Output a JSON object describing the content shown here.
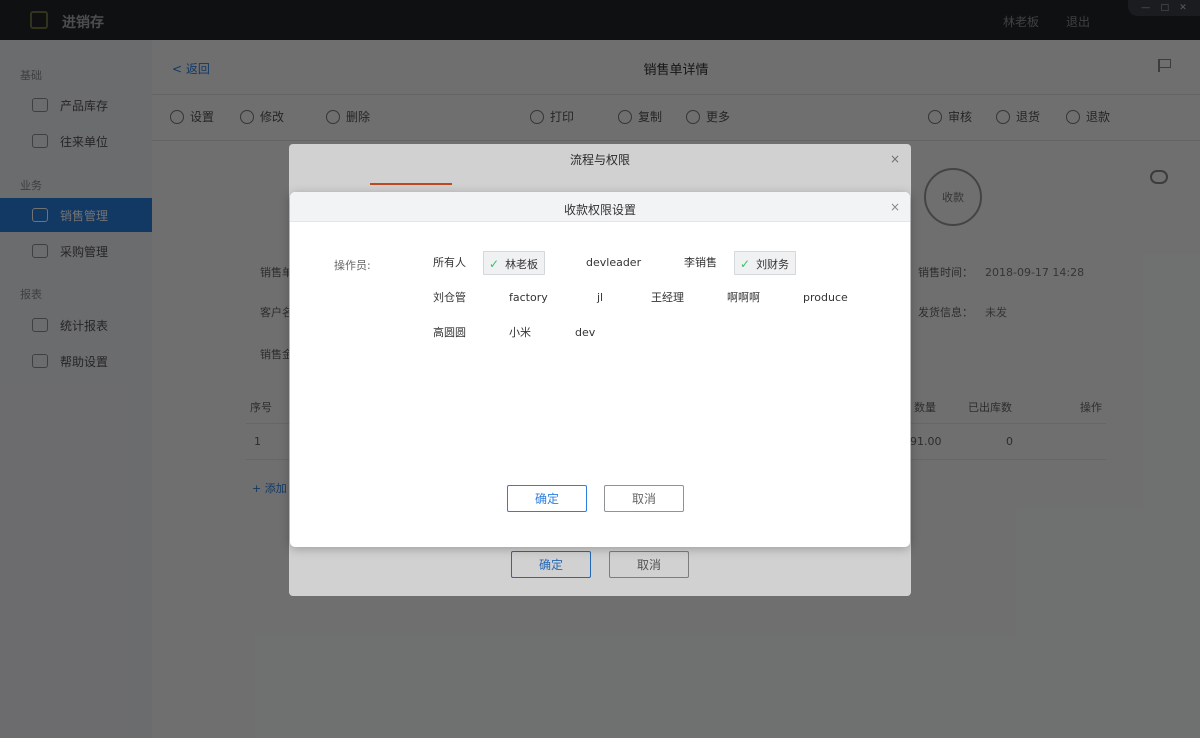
{
  "app": {
    "title": "进销存",
    "user_name": "林老板",
    "logout_label": "退出",
    "window_controls": [
      "—",
      "□",
      "✕"
    ]
  },
  "sidebar": {
    "groups": [
      "基础",
      "业务",
      "报表"
    ],
    "items": [
      {
        "label": "产品库存",
        "icon": "tag-icon"
      },
      {
        "label": "往来单位",
        "icon": "contacts-icon"
      },
      {
        "label": "销售管理",
        "icon": "sales-icon",
        "active": true
      },
      {
        "label": "采购管理",
        "icon": "purchase-icon"
      },
      {
        "label": "统计报表",
        "icon": "chart-icon"
      },
      {
        "label": "帮助设置",
        "icon": "gear-icon"
      }
    ]
  },
  "main": {
    "back_label": "< 返回",
    "page_title": "销售单详情",
    "toolbar": {
      "settings": "设置",
      "edit": "修改",
      "delete": "删除",
      "print": "打印",
      "copy": "复制",
      "more": "更多",
      "review": "审核",
      "return_goods": "退货",
      "refund": "退款"
    },
    "stamp": "收款",
    "info_left": [
      "销售单号",
      "客户名称",
      "销售金额"
    ],
    "info_right": [
      {
        "label": "销售时间：",
        "value": "2018-09-17 14:28"
      },
      {
        "label": "发货信息：",
        "value": "未发"
      }
    ],
    "table": {
      "headers": [
        "序号",
        "数量",
        "已出库数",
        "操作"
      ],
      "row": {
        "index": "1",
        "qty": "91.00",
        "out": "0"
      }
    },
    "add_row": "+ 添加"
  },
  "outer_dialog": {
    "title": "流程与权限",
    "close": "×",
    "ok": "确定",
    "cancel": "取消"
  },
  "dialog": {
    "title": "收款权限设置",
    "close": "×",
    "operator_label": "操作员:",
    "operators": [
      {
        "name": "所有人",
        "checked": false
      },
      {
        "name": "林老板",
        "checked": true
      },
      {
        "name": "devleader",
        "checked": false
      },
      {
        "name": "李销售",
        "checked": false
      },
      {
        "name": "刘财务",
        "checked": true
      },
      {
        "name": "刘仓管",
        "checked": false
      },
      {
        "name": "factory",
        "checked": false
      },
      {
        "name": "jl",
        "checked": false
      },
      {
        "name": "王经理",
        "checked": false
      },
      {
        "name": "啊啊啊",
        "checked": false
      },
      {
        "name": "produce",
        "checked": false
      },
      {
        "name": "高圆圆",
        "checked": false
      },
      {
        "name": "小米",
        "checked": false
      },
      {
        "name": "dev",
        "checked": false
      }
    ],
    "ok": "确定",
    "cancel": "取消",
    "check_icon": "✓",
    "accent_color": "#2b7fe0",
    "check_color": "#36c26a"
  }
}
